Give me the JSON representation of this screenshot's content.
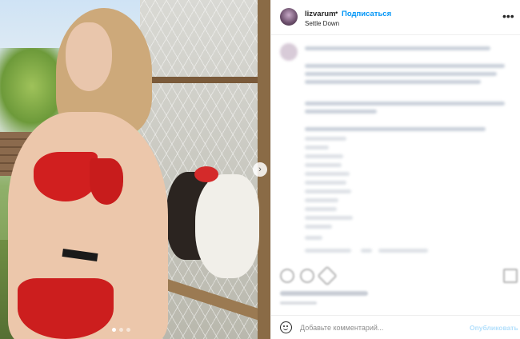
{
  "post": {
    "username": "lizvarum",
    "separator": "•",
    "follow_label": "Подписаться",
    "location": "Settle Down",
    "more_icon": "more-horizontal-icon"
  },
  "media": {
    "next_icon": "chevron-right-icon",
    "next_glyph": "›",
    "carousel_slides": 3,
    "active_slide": 1
  },
  "composer": {
    "placeholder": "Добавьте комментарий...",
    "publish_label": "Опубликовать"
  },
  "colors": {
    "accent": "#0095f6",
    "publish_disabled": "#b2dffc",
    "text": "#262626",
    "muted": "#8e8e8e"
  }
}
